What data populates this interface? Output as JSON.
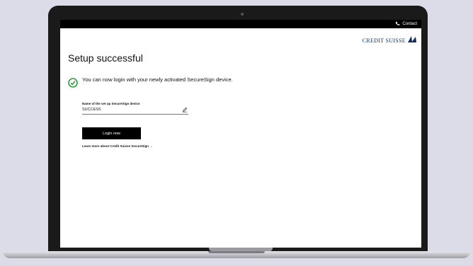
{
  "topbar": {
    "contact_label": "Contact"
  },
  "logo": {
    "text": "CREDIT SUISSE"
  },
  "page": {
    "title": "Setup successful",
    "success_message": "You can now login with your newly activated SecureSign device."
  },
  "device_field": {
    "label": "Name of the set up SecureSign device",
    "value": "SUCCESS"
  },
  "login_button": {
    "label": "Login now"
  },
  "learn_more": {
    "label": "Learn more about Credit Suisse SecureSign →"
  },
  "colors": {
    "success_green": "#2e9e3e",
    "brand_blue": "#0d2b5c"
  }
}
